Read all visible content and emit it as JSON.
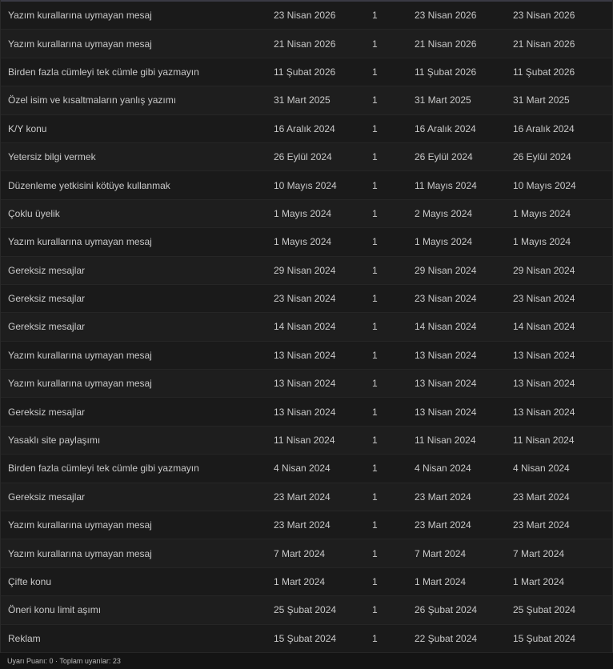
{
  "warnings": [
    {
      "reason": "Yazım kurallarına uymayan mesaj",
      "date": "23 Nisan 2026",
      "points": "1",
      "expiry": "23 Nisan 2026",
      "end": "23 Nisan 2026"
    },
    {
      "reason": "Yazım kurallarına uymayan mesaj",
      "date": "21 Nisan 2026",
      "points": "1",
      "expiry": "21 Nisan 2026",
      "end": "21 Nisan 2026"
    },
    {
      "reason": "Birden fazla cümleyi tek cümle gibi yazmayın",
      "date": "11 Şubat 2026",
      "points": "1",
      "expiry": "11 Şubat 2026",
      "end": "11 Şubat 2026"
    },
    {
      "reason": "Özel isim ve kısaltmaların yanlış yazımı",
      "date": "31 Mart 2025",
      "points": "1",
      "expiry": "31 Mart 2025",
      "end": "31 Mart 2025"
    },
    {
      "reason": "K/Y konu",
      "date": "16 Aralık 2024",
      "points": "1",
      "expiry": "16 Aralık 2024",
      "end": "16 Aralık 2024"
    },
    {
      "reason": "Yetersiz bilgi vermek",
      "date": "26 Eylül 2024",
      "points": "1",
      "expiry": "26 Eylül 2024",
      "end": "26 Eylül 2024"
    },
    {
      "reason": "Düzenleme yetkisini kötüye kullanmak",
      "date": "10 Mayıs 2024",
      "points": "1",
      "expiry": "11 Mayıs 2024",
      "end": "10 Mayıs 2024"
    },
    {
      "reason": "Çoklu üyelik",
      "date": "1 Mayıs 2024",
      "points": "1",
      "expiry": "2 Mayıs 2024",
      "end": "1 Mayıs 2024"
    },
    {
      "reason": "Yazım kurallarına uymayan mesaj",
      "date": "1 Mayıs 2024",
      "points": "1",
      "expiry": "1 Mayıs 2024",
      "end": "1 Mayıs 2024"
    },
    {
      "reason": "Gereksiz mesajlar",
      "date": "29 Nisan 2024",
      "points": "1",
      "expiry": "29 Nisan 2024",
      "end": "29 Nisan 2024"
    },
    {
      "reason": "Gereksiz mesajlar",
      "date": "23 Nisan 2024",
      "points": "1",
      "expiry": "23 Nisan 2024",
      "end": "23 Nisan 2024"
    },
    {
      "reason": "Gereksiz mesajlar",
      "date": "14 Nisan 2024",
      "points": "1",
      "expiry": "14 Nisan 2024",
      "end": "14 Nisan 2024"
    },
    {
      "reason": "Yazım kurallarına uymayan mesaj",
      "date": "13 Nisan 2024",
      "points": "1",
      "expiry": "13 Nisan 2024",
      "end": "13 Nisan 2024"
    },
    {
      "reason": "Yazım kurallarına uymayan mesaj",
      "date": "13 Nisan 2024",
      "points": "1",
      "expiry": "13 Nisan 2024",
      "end": "13 Nisan 2024"
    },
    {
      "reason": "Gereksiz mesajlar",
      "date": "13 Nisan 2024",
      "points": "1",
      "expiry": "13 Nisan 2024",
      "end": "13 Nisan 2024"
    },
    {
      "reason": "Yasaklı site paylaşımı",
      "date": "11 Nisan 2024",
      "points": "1",
      "expiry": "11 Nisan 2024",
      "end": "11 Nisan 2024"
    },
    {
      "reason": "Birden fazla cümleyi tek cümle gibi yazmayın",
      "date": "4 Nisan 2024",
      "points": "1",
      "expiry": "4 Nisan 2024",
      "end": "4 Nisan 2024"
    },
    {
      "reason": "Gereksiz mesajlar",
      "date": "23 Mart 2024",
      "points": "1",
      "expiry": "23 Mart 2024",
      "end": "23 Mart 2024"
    },
    {
      "reason": "Yazım kurallarına uymayan mesaj",
      "date": "23 Mart 2024",
      "points": "1",
      "expiry": "23 Mart 2024",
      "end": "23 Mart 2024"
    },
    {
      "reason": "Yazım kurallarına uymayan mesaj",
      "date": "7 Mart 2024",
      "points": "1",
      "expiry": "7 Mart 2024",
      "end": "7 Mart 2024"
    },
    {
      "reason": "Çifte konu",
      "date": "1 Mart 2024",
      "points": "1",
      "expiry": "1 Mart 2024",
      "end": "1 Mart 2024"
    },
    {
      "reason": "Öneri konu limit aşımı",
      "date": "25 Şubat 2024",
      "points": "1",
      "expiry": "26 Şubat 2024",
      "end": "25 Şubat 2024"
    },
    {
      "reason": "Reklam",
      "date": "15 Şubat 2024",
      "points": "1",
      "expiry": "22 Şubat 2024",
      "end": "15 Şubat 2024"
    }
  ],
  "footer": {
    "summary": "Uyarı Puanı: 0 · Toplam uyarılar: 23"
  },
  "colors": {
    "background": "#141414",
    "row_odd": "#1a1a1a",
    "row_even": "#1e1e1e",
    "row_border": "#262626",
    "text": "#c9c9c9"
  }
}
